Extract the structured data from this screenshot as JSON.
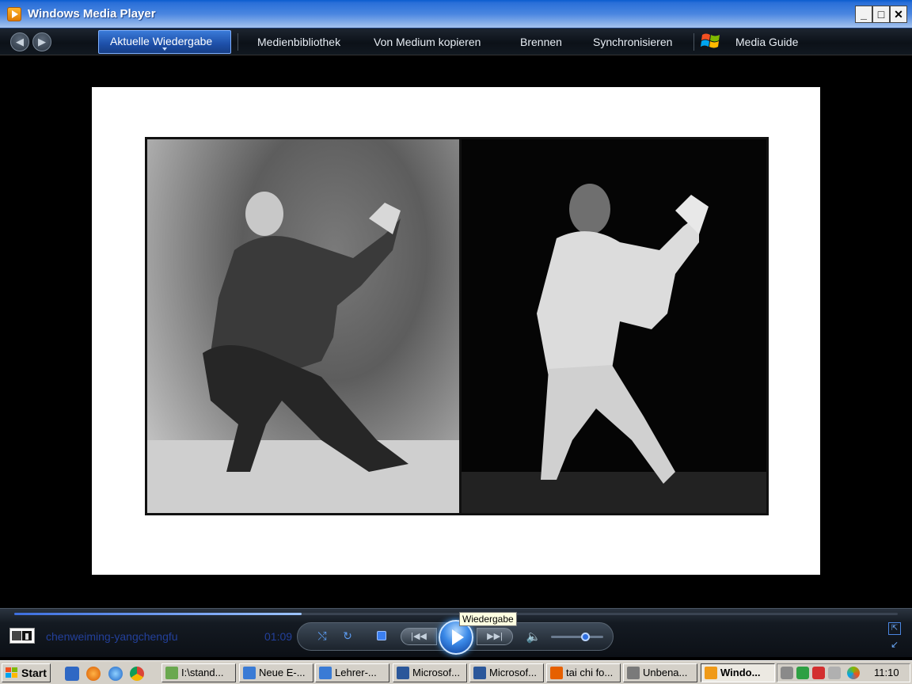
{
  "window": {
    "title": "Windows Media Player",
    "minimize": "_",
    "maximize": "□",
    "close": "✕"
  },
  "nav": {
    "back_icon": "◀",
    "forward_icon": "▶",
    "tabs": [
      {
        "id": "now-playing",
        "label": "Aktuelle Wiedergabe",
        "active": true
      },
      {
        "id": "library",
        "label": "Medienbibliothek"
      },
      {
        "id": "rip",
        "label": "Von Medium kopieren"
      },
      {
        "id": "burn",
        "label": "Brennen"
      },
      {
        "id": "sync",
        "label": "Synchronisieren"
      },
      {
        "id": "guide",
        "label": "Media Guide"
      }
    ]
  },
  "player": {
    "media_title": "chenweiming-yangchengfu",
    "time_elapsed": "01:09",
    "progress_fraction": 0.325,
    "volume_fraction": 0.72,
    "shuffle_icon": "⤭",
    "repeat_icon": "↻",
    "prev_icon": "|◀◀",
    "next_icon": "▶▶|",
    "volume_icon": "🔈",
    "tooltip": "Wiedergabe",
    "accent_color": "#3b8ae8"
  },
  "taskbar": {
    "start_label": "Start",
    "tasks": [
      {
        "label": "I:\\stand...",
        "icon": "folder-edit-icon",
        "color": "#6aa84f"
      },
      {
        "label": "Neue E-...",
        "icon": "ie-icon",
        "color": "#3a7bd5"
      },
      {
        "label": "Lehrer-...",
        "icon": "ie-icon",
        "color": "#3a7bd5"
      },
      {
        "label": "Microsof...",
        "icon": "word-icon",
        "color": "#2b579a"
      },
      {
        "label": "Microsof...",
        "icon": "word-icon",
        "color": "#2b579a"
      },
      {
        "label": "tai chi fo...",
        "icon": "firefox-icon",
        "color": "#e66000"
      },
      {
        "label": "Unbena...",
        "icon": "paint-icon",
        "color": "#7a7a7a"
      },
      {
        "label": "Windo...",
        "icon": "wmp-icon",
        "color": "#f09a17",
        "active": true
      }
    ],
    "clock": "11:10"
  }
}
